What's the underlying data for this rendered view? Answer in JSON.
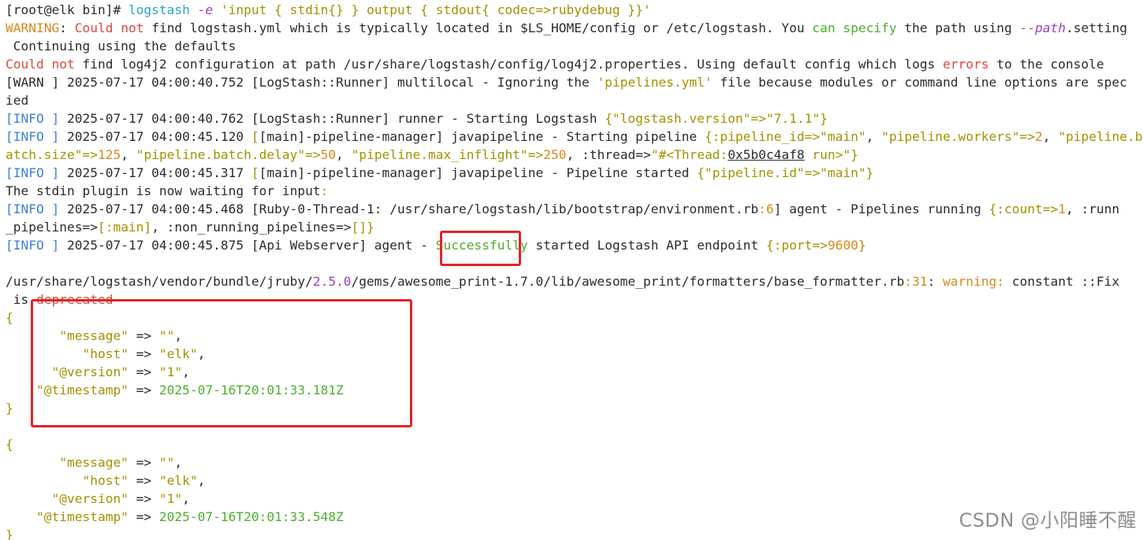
{
  "terminal": {
    "lines": [
      [
        [
          "[root@elk bin]# ",
          "plain"
        ],
        [
          "logstash",
          "cmd"
        ],
        [
          " ",
          "plain"
        ],
        [
          "-e",
          "flag"
        ],
        [
          " 'input { stdin{} } output { stdout{ codec=>rubydebug }}'",
          "yellow"
        ]
      ],
      [
        [
          "WARNING",
          "orange"
        ],
        [
          ": ",
          "plain"
        ],
        [
          "Could not",
          "red"
        ],
        [
          " find logstash.yml which is typically located in $LS_HOME/config or /etc/logstash. You ",
          "plain"
        ],
        [
          "can specify",
          "green"
        ],
        [
          " the path using ",
          "plain"
        ],
        [
          "--",
          "red"
        ],
        [
          "path",
          "flag"
        ],
        [
          ".setting",
          "plain"
        ]
      ],
      [
        [
          " Continuing using the defaults",
          "plain"
        ]
      ],
      [
        [
          "Could not",
          "red"
        ],
        [
          " find log4j2 configuration at path /usr/share/logstash/config/log4j2.properties. Using default config which logs ",
          "plain"
        ],
        [
          "errors",
          "red"
        ],
        [
          " to the console",
          "plain"
        ]
      ],
      [
        [
          "[WARN ]",
          "plain"
        ],
        [
          " 2025-07-17 04:00:40.752 [LogStash::Runner] multilocal - Ignoring the ",
          "plain"
        ],
        [
          "'pipelines.yml'",
          "yellow"
        ],
        [
          " file because modules or command line options are spec",
          "plain"
        ]
      ],
      [
        [
          "ied",
          "plain"
        ]
      ],
      [
        [
          "[INFO ]",
          "blue"
        ],
        [
          " 2025-07-17 04:00:40.762 [LogStash::Runner] runner - Starting Logstash ",
          "plain"
        ],
        [
          "{\"logstash.version\"=>\"7.1.1\"}",
          "yellow"
        ]
      ],
      [
        [
          "[INFO ]",
          "blue"
        ],
        [
          " 2025-07-17 04:00:45.120 ",
          "plain"
        ],
        [
          "[",
          "yellow"
        ],
        [
          "[main]-pipeline-manager] javapipeline - Starting pipeline ",
          "plain"
        ],
        [
          "{:pipeline_id=>",
          "yellow"
        ],
        [
          "\"main\"",
          "yellow"
        ],
        [
          ", ",
          "plain"
        ],
        [
          "\"pipeline.workers\"=>",
          "yellow"
        ],
        [
          "2",
          "orange"
        ],
        [
          ", ",
          "plain"
        ],
        [
          "\"pipeline.b",
          "yellow"
        ]
      ],
      [
        [
          "atch.size\"=>",
          "yellow"
        ],
        [
          "125",
          "orange"
        ],
        [
          ", ",
          "plain"
        ],
        [
          "\"pipeline.batch.delay\"=>",
          "yellow"
        ],
        [
          "50",
          "orange"
        ],
        [
          ", ",
          "plain"
        ],
        [
          "\"pipeline.max_inflight\"=>",
          "yellow"
        ],
        [
          "250",
          "orange"
        ],
        [
          ", :thread=>",
          "plain"
        ],
        [
          "\"#<Thread:",
          "yellow"
        ],
        [
          "0x5b0c4af8",
          "under"
        ],
        [
          " run>\"}",
          "yellow"
        ]
      ],
      [
        [
          "[INFO ]",
          "blue"
        ],
        [
          " 2025-07-17 04:00:45.317 ",
          "plain"
        ],
        [
          "[",
          "yellow"
        ],
        [
          "[main]-pipeline-manager] javapipeline - Pipeline started ",
          "plain"
        ],
        [
          "{\"pipeline.id\"=>\"main\"}",
          "yellow"
        ]
      ],
      [
        [
          "The stdin plugin is now waiting for input",
          "plain"
        ],
        [
          ":",
          "yellow"
        ]
      ],
      [
        [
          "[INFO ]",
          "blue"
        ],
        [
          " 2025-07-17 04:00:45.468 [Ruby-0-Thread-1: /usr/share/logstash/lib/bootstrap/environment.rb",
          "plain"
        ],
        [
          ":6",
          "orange"
        ],
        [
          "] agent - Pipelines running ",
          "plain"
        ],
        [
          "{:count=>",
          "yellow"
        ],
        [
          "1",
          "orange"
        ],
        [
          ", :runn",
          "plain"
        ]
      ],
      [
        [
          "_pipelines=>",
          "plain"
        ],
        [
          "[:main]",
          "yellow"
        ],
        [
          ", :non_running_pipelines=>",
          "plain"
        ],
        [
          "[]}",
          "yellow"
        ]
      ],
      [
        [
          "[INFO ]",
          "blue"
        ],
        [
          " 2025-07-17 04:00:45.875 [Api Webserver] agent - ",
          "plain"
        ],
        [
          "Successfully",
          "green"
        ],
        [
          " started Logstash API endpoint ",
          "plain"
        ],
        [
          "{:port=>",
          "yellow"
        ],
        [
          "9600",
          "orange"
        ],
        [
          "}",
          "yellow"
        ]
      ],
      [
        [
          "",
          "plain"
        ]
      ],
      [
        [
          "/usr/share/logstash/vendor/bundle/jruby/",
          "plain"
        ],
        [
          "2.5.0",
          "purple"
        ],
        [
          "/gems/awesome_print-1.7.0/lib/awesome_print/formatters/base_formatter.rb",
          "plain"
        ],
        [
          ":31",
          "orange"
        ],
        [
          ": ",
          "plain"
        ],
        [
          "warning:",
          "orange"
        ],
        [
          " constant ::Fix",
          "plain"
        ]
      ],
      [
        [
          " is ",
          "plain"
        ],
        [
          "deprecated",
          "red"
        ]
      ],
      [
        [
          "{",
          "brace"
        ]
      ],
      [
        [
          "       \"message\"",
          "key"
        ],
        [
          " => ",
          "plain"
        ],
        [
          "\"\"",
          "yellow"
        ],
        [
          ",",
          "plain"
        ]
      ],
      [
        [
          "          \"host\"",
          "key"
        ],
        [
          " => ",
          "plain"
        ],
        [
          "\"elk\"",
          "yellow"
        ],
        [
          ",",
          "plain"
        ]
      ],
      [
        [
          "      \"@version\"",
          "key"
        ],
        [
          " => ",
          "plain"
        ],
        [
          "\"1\"",
          "yellow"
        ],
        [
          ",",
          "plain"
        ]
      ],
      [
        [
          "    \"@timestamp\"",
          "key"
        ],
        [
          " => ",
          "plain"
        ],
        [
          "2025-07-16T20:01:33.181Z",
          "green"
        ]
      ],
      [
        [
          "}",
          "brace"
        ]
      ],
      [
        [
          "",
          "plain"
        ]
      ],
      [
        [
          "{",
          "brace"
        ]
      ],
      [
        [
          "       \"message\"",
          "key"
        ],
        [
          " => ",
          "plain"
        ],
        [
          "\"\"",
          "yellow"
        ],
        [
          ",",
          "plain"
        ]
      ],
      [
        [
          "          \"host\"",
          "key"
        ],
        [
          " => ",
          "plain"
        ],
        [
          "\"elk\"",
          "yellow"
        ],
        [
          ",",
          "plain"
        ]
      ],
      [
        [
          "      \"@version\"",
          "key"
        ],
        [
          " => ",
          "plain"
        ],
        [
          "\"1\"",
          "yellow"
        ],
        [
          ",",
          "plain"
        ]
      ],
      [
        [
          "    \"@timestamp\"",
          "key"
        ],
        [
          " => ",
          "plain"
        ],
        [
          "2025-07-16T20:01:33.548Z",
          "green"
        ]
      ],
      [
        [
          "}",
          "brace"
        ]
      ]
    ]
  },
  "watermark": {
    "text": "CSDN @小阳睡不醒"
  },
  "colors": {
    "background": "#ffffff",
    "text": "#2b2b2b",
    "command": "#2ea0d0",
    "error_red": "#e0463d",
    "success_green": "#4cae2c",
    "string_yellow": "#a39100",
    "number_orange": "#d6891d",
    "info_blue": "#3d7fd9",
    "highlight_box": "#e02424"
  }
}
